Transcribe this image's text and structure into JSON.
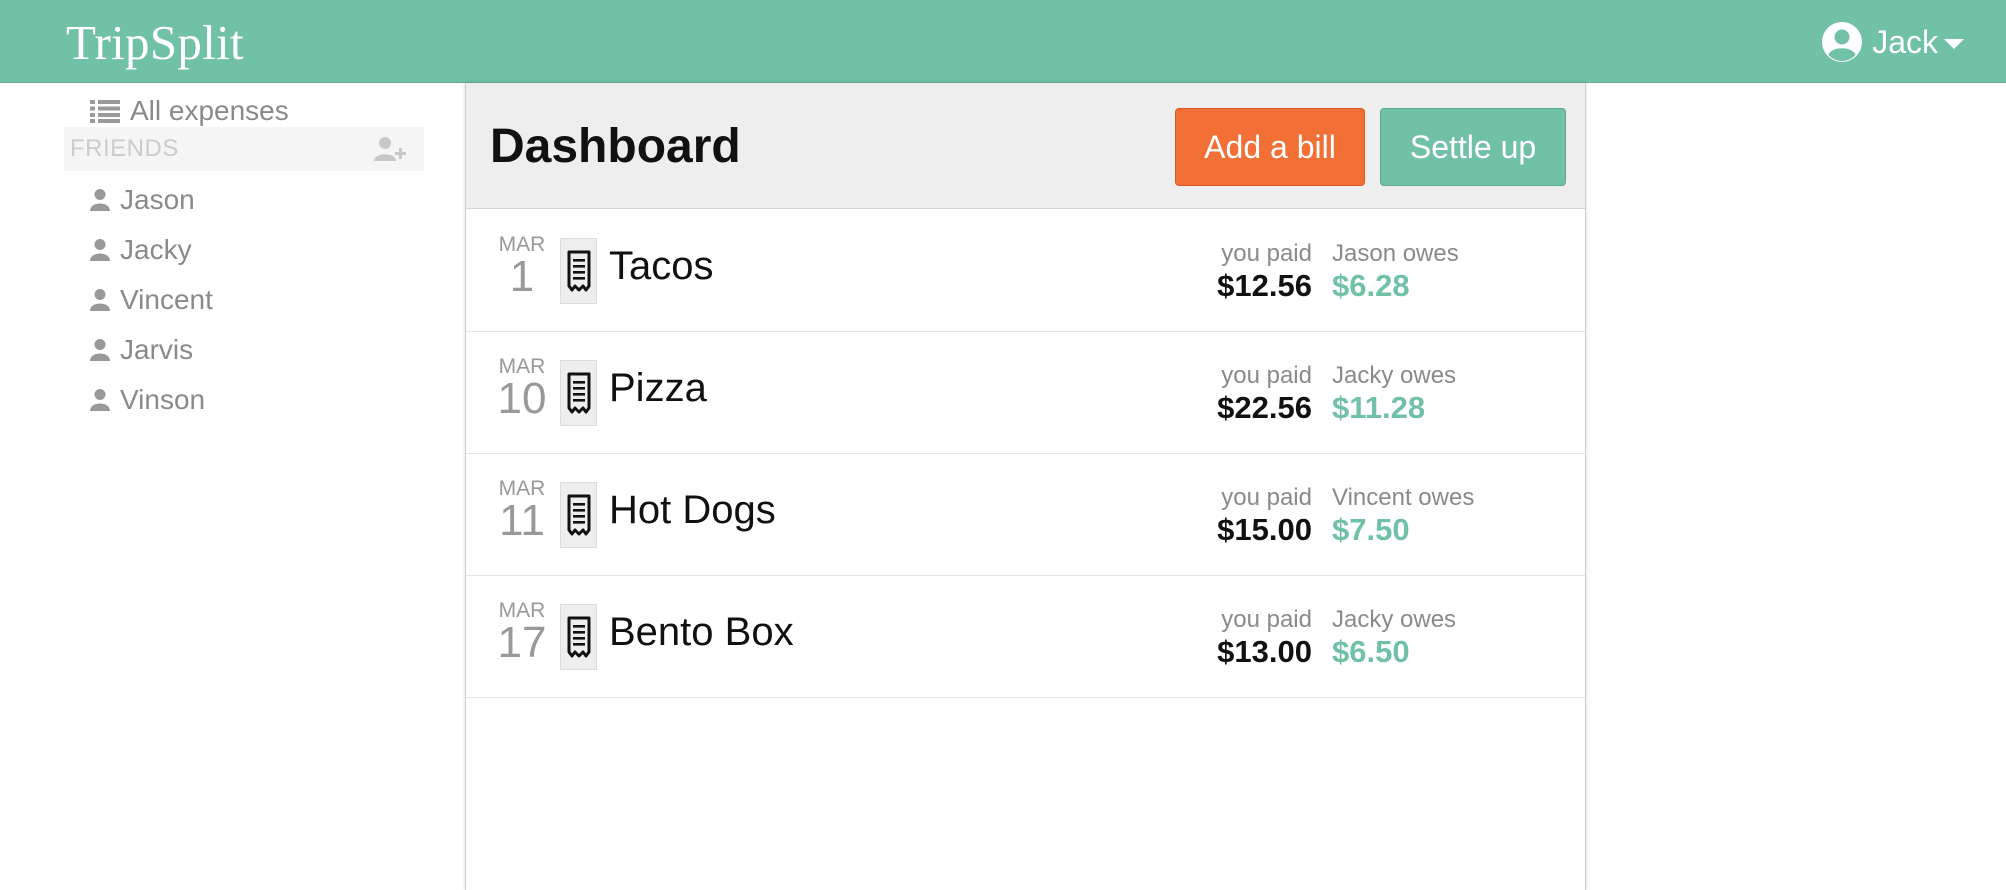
{
  "app": {
    "brand": "TripSplit"
  },
  "user": {
    "name": "Jack"
  },
  "sidebar": {
    "all_expenses": "All expenses",
    "friends_title": "FRIENDS",
    "friends": [
      "Jason",
      "Jacky",
      "Vincent",
      "Jarvis",
      "Vinson"
    ]
  },
  "dashboard": {
    "title": "Dashboard",
    "add_bill": "Add a bill",
    "settle_up": "Settle up"
  },
  "expenses": [
    {
      "month": "MAR",
      "day": "1",
      "name": "Tacos",
      "paid_label": "you paid",
      "paid": "$12.56",
      "owes_label": "Jason owes",
      "owed": "$6.28"
    },
    {
      "month": "MAR",
      "day": "10",
      "name": "Pizza",
      "paid_label": "you paid",
      "paid": "$22.56",
      "owes_label": "Jacky owes",
      "owed": "$11.28"
    },
    {
      "month": "MAR",
      "day": "11",
      "name": "Hot Dogs",
      "paid_label": "you paid",
      "paid": "$15.00",
      "owes_label": "Vincent owes",
      "owed": "$7.50"
    },
    {
      "month": "MAR",
      "day": "17",
      "name": "Bento Box",
      "paid_label": "you paid",
      "paid": "$13.00",
      "owes_label": "Jacky owes",
      "owed": "$6.50"
    }
  ],
  "colors": {
    "brand": "#71c1a6",
    "add_bill": "#f26f35",
    "owed": "#71c1a6"
  },
  "icons": {
    "user": "user-circle-icon",
    "list": "list-icon",
    "add_friend": "add-user-icon",
    "friend": "user-icon",
    "receipt": "receipt-icon"
  }
}
